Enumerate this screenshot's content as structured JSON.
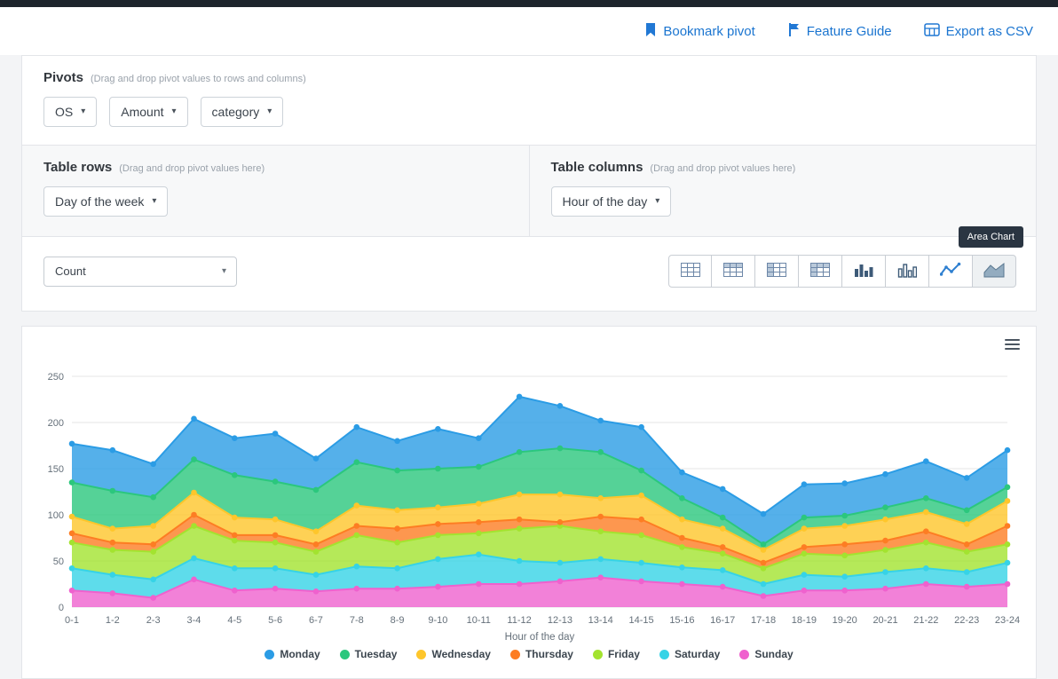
{
  "header": {
    "actions": [
      {
        "label": "Bookmark pivot",
        "icon": "bookmark-icon"
      },
      {
        "label": "Feature Guide",
        "icon": "flag-icon"
      },
      {
        "label": "Export as CSV",
        "icon": "csv-icon"
      }
    ]
  },
  "pivots": {
    "title": "Pivots",
    "hint": "(Drag and drop pivot values to rows and columns)",
    "fields": [
      "OS",
      "Amount",
      "category"
    ]
  },
  "table_rows": {
    "title": "Table rows",
    "hint": "(Drag and drop pivot values here)",
    "value": "Day of the week"
  },
  "table_columns": {
    "title": "Table columns",
    "hint": "(Drag and drop pivot values here)",
    "value": "Hour of the day"
  },
  "controls": {
    "aggregation_value": "Count",
    "tooltip": "Area Chart",
    "view_buttons": [
      "table",
      "table-heatmap",
      "table-row-heatmap",
      "table-col-heatmap",
      "bar-chart",
      "column-chart",
      "line-chart",
      "area-chart"
    ]
  },
  "chart_data": {
    "type": "area",
    "stacked": true,
    "title": "",
    "xlabel": "Hour of the day",
    "ylabel": "",
    "ylim": [
      0,
      250
    ],
    "yticks": [
      0,
      50,
      100,
      150,
      200,
      250
    ],
    "grid": true,
    "legend_position": "bottom",
    "categories": [
      "0-1",
      "1-2",
      "2-3",
      "3-4",
      "4-5",
      "5-6",
      "6-7",
      "7-8",
      "8-9",
      "9-10",
      "10-11",
      "11-12",
      "12-13",
      "13-14",
      "14-15",
      "15-16",
      "16-17",
      "17-18",
      "18-19",
      "19-20",
      "20-21",
      "21-22",
      "22-23",
      "23-24"
    ],
    "series": [
      {
        "name": "Monday",
        "color": "#2b9ce5",
        "values": [
          42,
          44,
          36,
          44,
          40,
          52,
          34,
          38,
          32,
          43,
          31,
          60,
          46,
          34,
          47,
          28,
          31,
          33,
          36,
          35,
          36,
          40,
          35,
          40
        ]
      },
      {
        "name": "Tuesday",
        "color": "#2bc77d",
        "values": [
          37,
          41,
          31,
          36,
          46,
          41,
          45,
          47,
          43,
          42,
          40,
          46,
          50,
          50,
          27,
          23,
          12,
          6,
          12,
          11,
          13,
          15,
          15,
          15
        ]
      },
      {
        "name": "Wednesday",
        "color": "#fec62b",
        "values": [
          18,
          15,
          20,
          24,
          19,
          17,
          14,
          22,
          20,
          18,
          20,
          27,
          30,
          20,
          26,
          20,
          20,
          14,
          20,
          20,
          23,
          21,
          22,
          27
        ]
      },
      {
        "name": "Thursday",
        "color": "#fd7d23",
        "values": [
          10,
          8,
          8,
          12,
          6,
          8,
          8,
          10,
          15,
          12,
          12,
          10,
          4,
          16,
          17,
          10,
          7,
          6,
          7,
          12,
          10,
          12,
          8,
          20
        ]
      },
      {
        "name": "Friday",
        "color": "#a3e32f",
        "values": [
          28,
          27,
          30,
          35,
          30,
          28,
          25,
          34,
          28,
          26,
          23,
          35,
          40,
          30,
          30,
          22,
          18,
          17,
          23,
          23,
          24,
          28,
          22,
          20
        ]
      },
      {
        "name": "Saturday",
        "color": "#36d3e6",
        "values": [
          24,
          20,
          20,
          23,
          24,
          22,
          18,
          24,
          22,
          30,
          32,
          25,
          20,
          20,
          20,
          18,
          18,
          13,
          17,
          15,
          18,
          17,
          16,
          23
        ]
      },
      {
        "name": "Sunday",
        "color": "#ef61ce",
        "values": [
          18,
          15,
          10,
          30,
          18,
          20,
          17,
          20,
          20,
          22,
          25,
          25,
          28,
          32,
          28,
          25,
          22,
          12,
          18,
          18,
          20,
          25,
          22,
          25
        ]
      }
    ],
    "stack_order_bottom_to_top": [
      "Sunday",
      "Saturday",
      "Friday",
      "Thursday",
      "Wednesday",
      "Tuesday",
      "Monday"
    ]
  }
}
